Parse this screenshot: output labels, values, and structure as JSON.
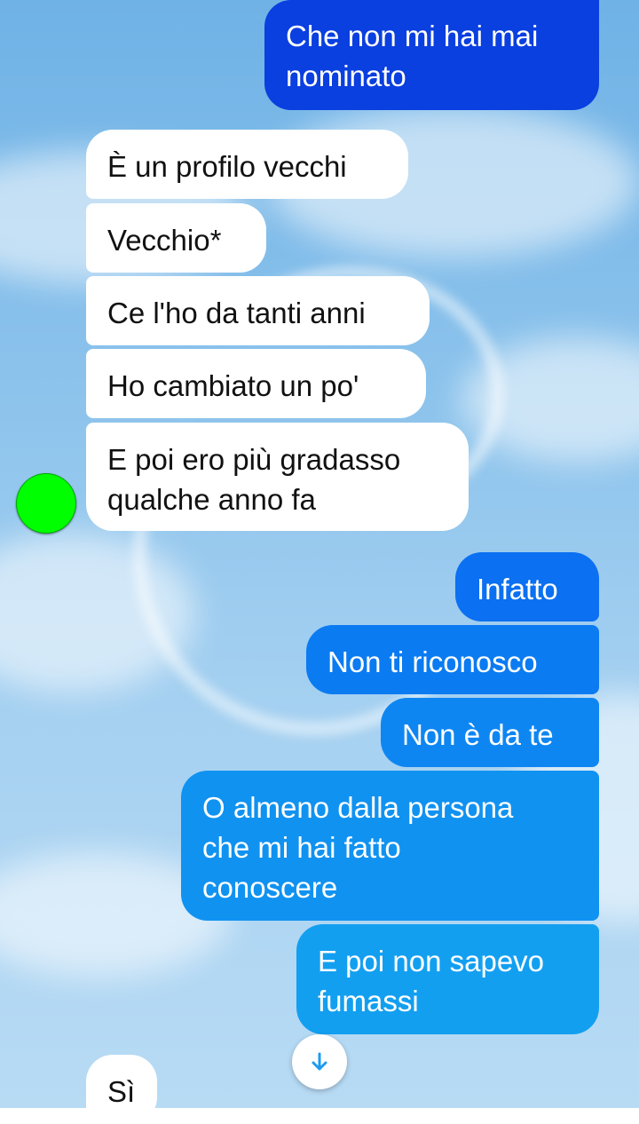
{
  "colors": {
    "sky_top": "#6fb2e6",
    "sky_bottom": "#b8dbf4",
    "incoming_bubble": "#ffffff",
    "outgoing_dark": "#0a3fe0",
    "outgoing_mid": "#0b7bf2",
    "outgoing_light": "#139ff0",
    "avatar": "#00ff00",
    "scroll_arrow": "#1e9bf0"
  },
  "messages": [
    {
      "text": "Che non mi hai mai\nnominato",
      "sender": "me"
    },
    {
      "text": "È un profilo vecchi",
      "sender": "contact"
    },
    {
      "text": "Vecchio*",
      "sender": "contact"
    },
    {
      "text": "Ce l'ho da tanti anni",
      "sender": "contact"
    },
    {
      "text": "Ho cambiato un po'",
      "sender": "contact"
    },
    {
      "text": "E poi ero più gradasso\nqualche anno fa",
      "sender": "contact"
    },
    {
      "text": "Infatto",
      "sender": "me"
    },
    {
      "text": "Non ti riconosco",
      "sender": "me"
    },
    {
      "text": "Non è da te",
      "sender": "me"
    },
    {
      "text": "O almeno dalla persona\nche mi hai fatto\nconoscere",
      "sender": "me"
    },
    {
      "text": "E poi non sapevo\nfumassi",
      "sender": "me"
    },
    {
      "text": "Sì",
      "sender": "contact"
    }
  ],
  "icons": {
    "avatar": "avatar-circle",
    "scroll_down": "arrow-down-icon"
  }
}
